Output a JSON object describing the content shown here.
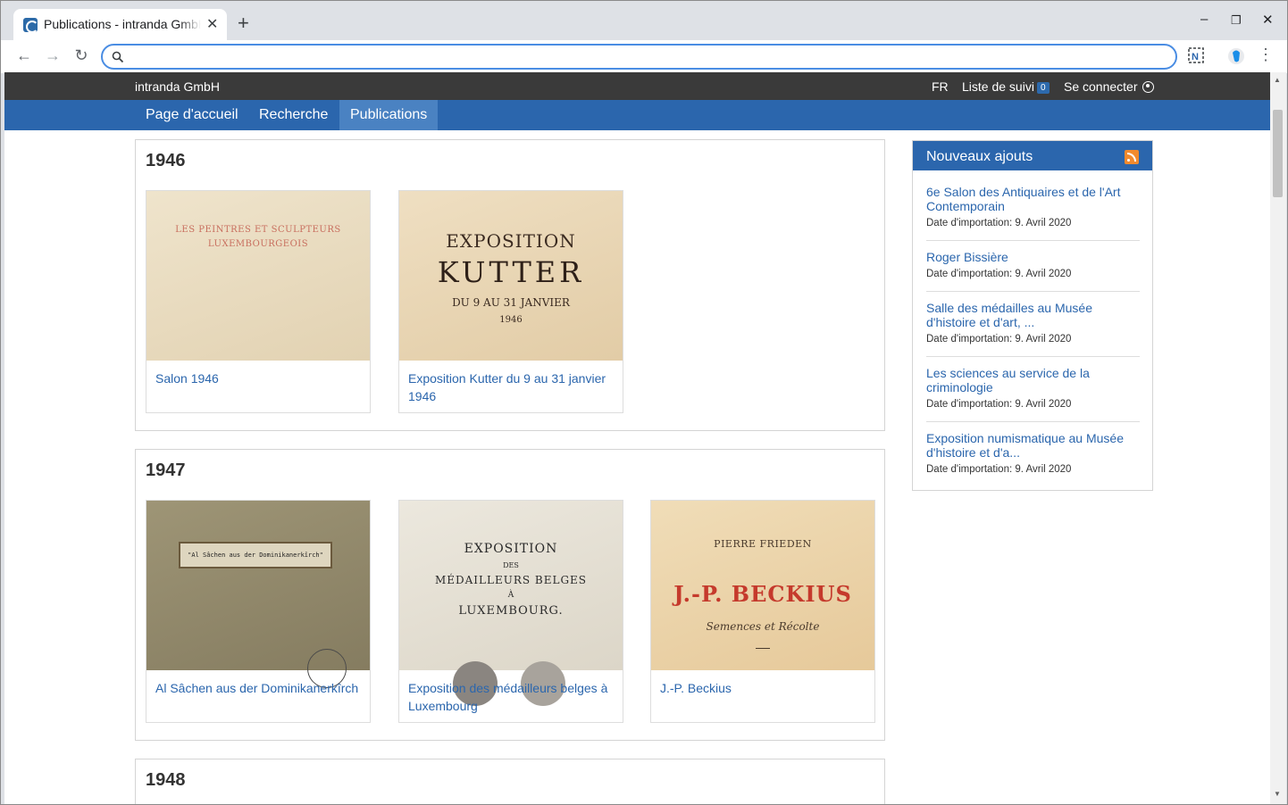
{
  "browser": {
    "tab_title": "Publications - intranda GmbH",
    "tab_close": "✕",
    "new_tab": "+",
    "minimize": "–",
    "maximize": "❐",
    "close": "✕",
    "address_value": "",
    "back_icon": "←",
    "forward_icon": "→",
    "reload_icon": "↻",
    "menu_icon": "⋮"
  },
  "topbar": {
    "brand": "intranda GmbH",
    "lang": "FR",
    "watchlist_label": "Liste de suivi",
    "watchlist_count": "0",
    "login_label": "Se connecter"
  },
  "nav": {
    "home": "Page d'accueil",
    "search": "Recherche",
    "publications": "Publications"
  },
  "years": [
    {
      "year": "1946",
      "items": [
        {
          "title": "Salon 1946",
          "cover_lines": [
            "LES PEINTRES ET SCULPTEURS",
            "LUXEMBOURGEOIS"
          ]
        },
        {
          "title": "Exposition Kutter du 9 au 31 janvier 1946",
          "cover_lines": [
            "EXPOSITION",
            "KUTTER",
            "DU 9 AU 31 JANVIER",
            "1946"
          ]
        }
      ]
    },
    {
      "year": "1947",
      "items": [
        {
          "title": "Al Sâchen aus der Dominikanerkîrch",
          "cover_lines": [
            "\"Al Sâchen aus der Dominikanerkîrch\""
          ]
        },
        {
          "title": "Exposition des médailleurs belges à Luxembourg",
          "cover_lines": [
            "EXPOSITION",
            "DES",
            "MÉDAILLEURS BELGES",
            "À",
            "LUXEMBOURG."
          ]
        },
        {
          "title": "J.-P. Beckius",
          "cover_lines": [
            "PIERRE FRIEDEN",
            "J.-P. BECKIUS",
            "Semences et Récolte"
          ]
        }
      ]
    },
    {
      "year": "1948",
      "items": []
    }
  ],
  "sidebar": {
    "title": "Nouveaux ajouts",
    "date_label": "Date d'importation:",
    "items": [
      {
        "title": "6e Salon des Antiquaires et de l'Art Contemporain",
        "date": "9. Avril 2020"
      },
      {
        "title": "Roger Bissière",
        "date": "9. Avril 2020"
      },
      {
        "title": "Salle des médailles au Musée d'histoire et d'art, ...",
        "date": "9. Avril 2020"
      },
      {
        "title": "Les sciences au service de la criminologie",
        "date": "9. Avril 2020"
      },
      {
        "title": "Exposition numismatique au Musée d'histoire et d'a...",
        "date": "9. Avril 2020"
      }
    ]
  }
}
